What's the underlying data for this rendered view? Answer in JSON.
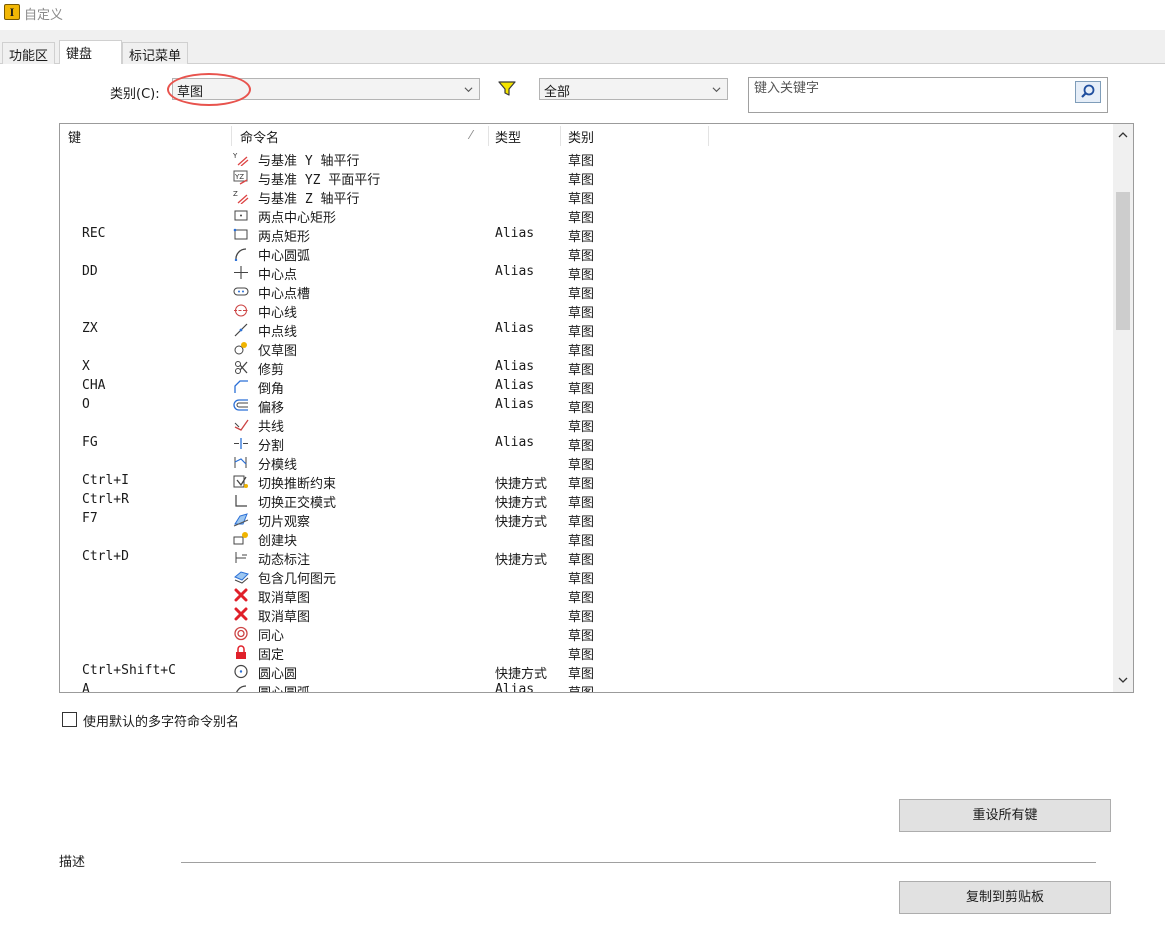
{
  "window": {
    "title": "自定义",
    "app_icon_letter": "I"
  },
  "tabs": [
    {
      "label": "功能区",
      "active": false
    },
    {
      "label": "键盘",
      "active": true
    },
    {
      "label": "标记菜单",
      "active": false
    }
  ],
  "category": {
    "label": "类别(C):",
    "value": "草图"
  },
  "filter": {
    "icon": "filter-icon",
    "value": "全部"
  },
  "search": {
    "placeholder": "键入关键字",
    "icon": "search-icon"
  },
  "table": {
    "columns": {
      "key": "键",
      "command": "命令名",
      "type": "类型",
      "category": "类别"
    },
    "sort_mark": "⁄",
    "rows": [
      {
        "key": "",
        "command": "与基准 Y 轴平行",
        "type": "",
        "category": "草图",
        "icon": "parallel-y-axis-icon"
      },
      {
        "key": "",
        "command": "与基准 YZ 平面平行",
        "type": "",
        "category": "草图",
        "icon": "parallel-yz-plane-icon"
      },
      {
        "key": "",
        "command": "与基准 Z 轴平行",
        "type": "",
        "category": "草图",
        "icon": "parallel-z-axis-icon"
      },
      {
        "key": "",
        "command": "两点中心矩形",
        "type": "",
        "category": "草图",
        "icon": "center-rectangle-icon"
      },
      {
        "key": "REC",
        "command": "两点矩形",
        "type": "Alias",
        "category": "草图",
        "icon": "two-point-rectangle-icon"
      },
      {
        "key": "",
        "command": "中心圆弧",
        "type": "",
        "category": "草图",
        "icon": "center-arc-icon"
      },
      {
        "key": "DD",
        "command": "中心点",
        "type": "Alias",
        "category": "草图",
        "icon": "center-point-icon"
      },
      {
        "key": "",
        "command": "中心点槽",
        "type": "",
        "category": "草图",
        "icon": "center-slot-icon"
      },
      {
        "key": "",
        "command": "中心线",
        "type": "",
        "category": "草图",
        "icon": "centerline-icon"
      },
      {
        "key": "ZX",
        "command": "中点线",
        "type": "Alias",
        "category": "草图",
        "icon": "midpoint-line-icon"
      },
      {
        "key": "",
        "command": "仅草图",
        "type": "",
        "category": "草图",
        "icon": "sketch-only-icon"
      },
      {
        "key": "X",
        "command": "修剪",
        "type": "Alias",
        "category": "草图",
        "icon": "trim-icon"
      },
      {
        "key": "CHA",
        "command": "倒角",
        "type": "Alias",
        "category": "草图",
        "icon": "chamfer-icon"
      },
      {
        "key": "O",
        "command": "偏移",
        "type": "Alias",
        "category": "草图",
        "icon": "offset-icon"
      },
      {
        "key": "",
        "command": "共线",
        "type": "",
        "category": "草图",
        "icon": "collinear-icon"
      },
      {
        "key": "FG",
        "command": "分割",
        "type": "Alias",
        "category": "草图",
        "icon": "split-icon"
      },
      {
        "key": "",
        "command": "分模线",
        "type": "",
        "category": "草图",
        "icon": "parting-line-icon"
      },
      {
        "key": "Ctrl+I",
        "command": "切换推断约束",
        "type": "快捷方式",
        "category": "草图",
        "icon": "infer-constraints-icon"
      },
      {
        "key": "Ctrl+R",
        "command": "切换正交模式",
        "type": "快捷方式",
        "category": "草图",
        "icon": "ortho-mode-icon"
      },
      {
        "key": "F7",
        "command": "切片观察",
        "type": "快捷方式",
        "category": "草图",
        "icon": "slice-graphics-icon"
      },
      {
        "key": "",
        "command": "创建块",
        "type": "",
        "category": "草图",
        "icon": "create-block-icon"
      },
      {
        "key": "Ctrl+D",
        "command": "动态标注",
        "type": "快捷方式",
        "category": "草图",
        "icon": "dynamic-dimension-icon"
      },
      {
        "key": "",
        "command": "包含几何图元",
        "type": "",
        "category": "草图",
        "icon": "include-geometry-icon"
      },
      {
        "key": "",
        "command": "取消草图",
        "type": "",
        "category": "草图",
        "icon": "cancel-red-x-icon"
      },
      {
        "key": "",
        "command": "取消草图",
        "type": "",
        "category": "草图",
        "icon": "cancel-red-x-icon"
      },
      {
        "key": "",
        "command": "同心",
        "type": "",
        "category": "草图",
        "icon": "concentric-icon"
      },
      {
        "key": "",
        "command": "固定",
        "type": "",
        "category": "草图",
        "icon": "lock-icon"
      },
      {
        "key": "Ctrl+Shift+C",
        "command": "圆心圆",
        "type": "快捷方式",
        "category": "草图",
        "icon": "center-circle-icon"
      },
      {
        "key": "A",
        "command": "圆心圆弧",
        "type": "Alias",
        "category": "草图",
        "icon": "center-arc-icon"
      }
    ]
  },
  "options": {
    "use_default_aliases_label": "使用默认的多字符命令别名",
    "use_default_aliases_checked": false
  },
  "buttons": {
    "reset_all": "重设所有键",
    "copy_clipboard": "复制到剪贴板"
  },
  "description": {
    "label": "描述"
  },
  "colors": {
    "annotation_circle": "#e8534d",
    "filter_icon": "#f5e400",
    "cancel_icon": "#e0202a"
  }
}
